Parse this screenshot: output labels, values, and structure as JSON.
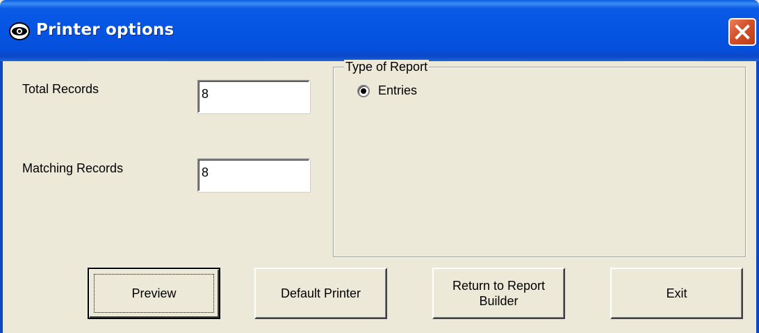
{
  "window": {
    "title": "Printer options",
    "icon": "eye-icon",
    "close_icon": "close-icon"
  },
  "fields": {
    "total_records_label": "Total Records",
    "total_records_value": "8",
    "matching_records_label": "Matching Records",
    "matching_records_value": "8"
  },
  "report_type": {
    "legend": "Type of Report",
    "options": [
      {
        "label": "Entries",
        "selected": true
      }
    ]
  },
  "buttons": {
    "preview": "Preview",
    "default_printer": "Default Printer",
    "return_to_builder": "Return to Report\nBuilder",
    "exit": "Exit"
  },
  "colors": {
    "titlebar": "#0554E3",
    "face": "#ECE9D8",
    "close": "#D2502A"
  }
}
